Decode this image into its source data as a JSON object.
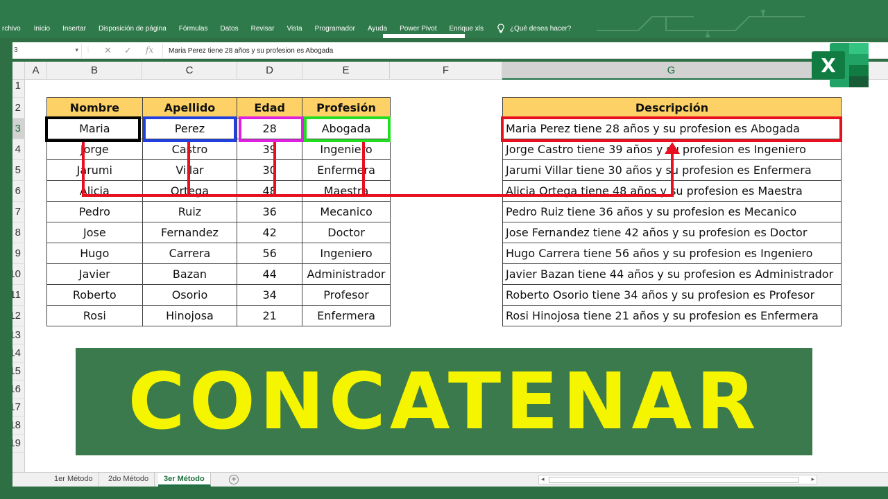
{
  "ribbon": {
    "menu": [
      "rchivo",
      "Inicio",
      "Insertar",
      "Disposición de página",
      "Fórmulas",
      "Datos",
      "Revisar",
      "Vista",
      "Programador",
      "Ayuda",
      "Power Pivot",
      "Enrique xls"
    ],
    "tell_me": "¿Qué desea hacer?",
    "accent_color": "#2f7a4a"
  },
  "formula_bar": {
    "name_box": "3",
    "cancel_glyph": "✕",
    "enter_glyph": "✓",
    "fx_glyph": "fx",
    "content": "Maria Perez tiene 28 años y su profesion es Abogada"
  },
  "columns": [
    "A",
    "B",
    "C",
    "D",
    "E",
    "F",
    "G"
  ],
  "rows": [
    "1",
    "2",
    "3",
    "4",
    "5",
    "6",
    "7",
    "8",
    "9",
    "10",
    "11",
    "12",
    "13",
    "14",
    "15",
    "16",
    "17",
    "18",
    "19"
  ],
  "data_table": {
    "headers": [
      "Nombre",
      "Apellido",
      "Edad",
      "Profesión"
    ],
    "rows": [
      [
        "Maria",
        "Perez",
        "28",
        "Abogada"
      ],
      [
        "Jorge",
        "Castro",
        "39",
        "Ingeniero"
      ],
      [
        "Jarumi",
        "Villar",
        "30",
        "Enfermera"
      ],
      [
        "Alicia",
        "Ortega",
        "48",
        "Maestra"
      ],
      [
        "Pedro",
        "Ruiz",
        "36",
        "Mecanico"
      ],
      [
        "Jose",
        "Fernandez",
        "42",
        "Doctor"
      ],
      [
        "Hugo",
        "Carrera",
        "56",
        "Ingeniero"
      ],
      [
        "Javier",
        "Bazan",
        "44",
        "Administrador"
      ],
      [
        "Roberto",
        "Osorio",
        "34",
        "Profesor"
      ],
      [
        "Rosi",
        "Hinojosa",
        "21",
        "Enfermera"
      ]
    ],
    "header_color": "#fdd166"
  },
  "desc_table": {
    "header": "Descripción",
    "rows": [
      "Maria Perez tiene 28 años y su profesion es Abogada",
      "Jorge Castro tiene 39 años y su profesion es Ingeniero",
      "Jarumi Villar tiene 30 años y su profesion es Enfermera",
      "Alicia Ortega tiene 48 años y su profesion es Maestra",
      "Pedro Ruiz tiene 36 años y su profesion es Mecanico",
      "Jose Fernandez tiene 42 años y su profesion es Doctor",
      "Hugo Carrera tiene 56 años y su profesion es Ingeniero",
      "Javier Bazan tiene 44 años y su profesion es Administrador",
      "Roberto Osorio tiene 34 años y su profesion es Profesor",
      "Rosi Hinojosa tiene 21 años y su profesion es Enfermera"
    ]
  },
  "highlight_colors": {
    "nombre": "#000000",
    "apellido": "#1f3fe0",
    "edad": "#e020e0",
    "profesion": "#22dd22",
    "arrows": "#e8101e"
  },
  "banner": {
    "text": "CONCATENAR",
    "text_color": "#f6f500",
    "bg_color": "#3a7a4c"
  },
  "logo": {
    "letter": "X"
  },
  "sheet_tabs": [
    "1er Método",
    "2do Método",
    "3er Método"
  ],
  "active_sheet": "3er Método",
  "add_sheet_glyph": "+"
}
